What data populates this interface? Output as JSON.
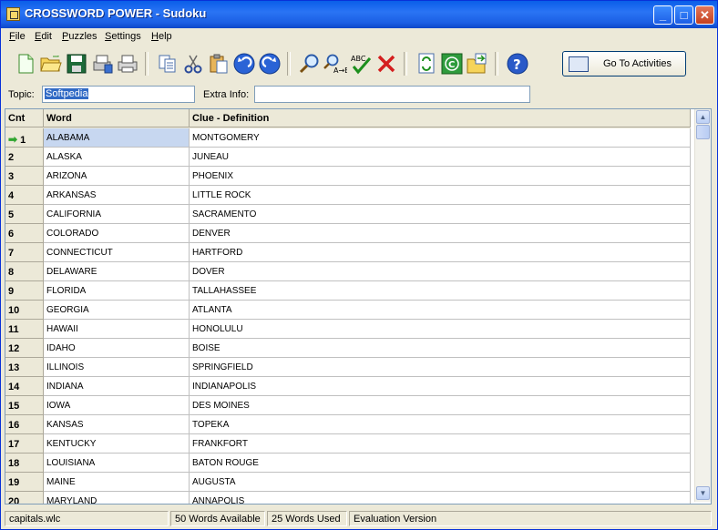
{
  "window": {
    "title": "CROSSWORD POWER - Sudoku",
    "controls": {
      "minimize": "_",
      "maximize": "□",
      "close": "✕"
    }
  },
  "menu": [
    {
      "label": "File",
      "accel": "F",
      "rest": "ile"
    },
    {
      "label": "Edit",
      "accel": "E",
      "rest": "dit"
    },
    {
      "label": "Puzzles",
      "accel": "P",
      "rest": "uzzles"
    },
    {
      "label": "Settings",
      "accel": "S",
      "rest": "ettings"
    },
    {
      "label": "Help",
      "accel": "H",
      "rest": "elp"
    }
  ],
  "toolbar": {
    "goto_label": "Go To Activities",
    "icons": [
      "new-file",
      "open-folder",
      "save",
      "print-setup",
      "print",
      "copy",
      "cut",
      "paste",
      "undo",
      "redo",
      "find",
      "find-replace",
      "spell-check",
      "delete",
      "refresh",
      "copyright",
      "export",
      "help"
    ]
  },
  "fields": {
    "topic_label": "Topic:",
    "topic_value": "Softpedia",
    "extra_label": "Extra Info:",
    "extra_value": ""
  },
  "grid": {
    "headers": {
      "cnt": "Cnt",
      "word": "Word",
      "clue": "Clue - Definition"
    },
    "rows": [
      {
        "cnt": "1",
        "word": "ALABAMA",
        "clue": "MONTGOMERY"
      },
      {
        "cnt": "2",
        "word": "ALASKA",
        "clue": "JUNEAU"
      },
      {
        "cnt": "3",
        "word": "ARIZONA",
        "clue": "PHOENIX"
      },
      {
        "cnt": "4",
        "word": "ARKANSAS",
        "clue": "LITTLE ROCK"
      },
      {
        "cnt": "5",
        "word": "CALIFORNIA",
        "clue": "SACRAMENTO"
      },
      {
        "cnt": "6",
        "word": "COLORADO",
        "clue": "DENVER"
      },
      {
        "cnt": "7",
        "word": "CONNECTICUT",
        "clue": "HARTFORD"
      },
      {
        "cnt": "8",
        "word": "DELAWARE",
        "clue": "DOVER"
      },
      {
        "cnt": "9",
        "word": "FLORIDA",
        "clue": "TALLAHASSEE"
      },
      {
        "cnt": "10",
        "word": "GEORGIA",
        "clue": "ATLANTA"
      },
      {
        "cnt": "11",
        "word": "HAWAII",
        "clue": "HONOLULU"
      },
      {
        "cnt": "12",
        "word": "IDAHO",
        "clue": "BOISE"
      },
      {
        "cnt": "13",
        "word": "ILLINOIS",
        "clue": "SPRINGFIELD"
      },
      {
        "cnt": "14",
        "word": "INDIANA",
        "clue": "INDIANAPOLIS"
      },
      {
        "cnt": "15",
        "word": "IOWA",
        "clue": "DES MOINES"
      },
      {
        "cnt": "16",
        "word": "KANSAS",
        "clue": "TOPEKA"
      },
      {
        "cnt": "17",
        "word": "KENTUCKY",
        "clue": "FRANKFORT"
      },
      {
        "cnt": "18",
        "word": "LOUISIANA",
        "clue": "BATON ROUGE"
      },
      {
        "cnt": "19",
        "word": "MAINE",
        "clue": "AUGUSTA"
      },
      {
        "cnt": "20",
        "word": "MARYLAND",
        "clue": "ANNAPOLIS"
      }
    ]
  },
  "status": {
    "file": "capitals.wlc",
    "available": "50 Words Available",
    "used": "25 Words Used",
    "version": "Evaluation Version"
  }
}
